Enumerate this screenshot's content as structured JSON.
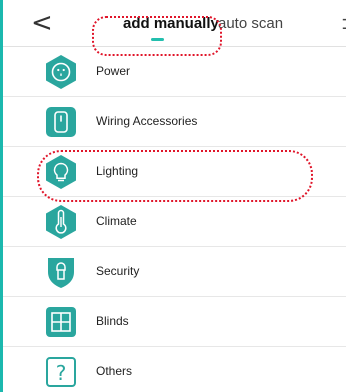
{
  "header": {
    "back_glyph": "<",
    "tabs": [
      {
        "label": "add manually",
        "active": true
      },
      {
        "label": "auto scan",
        "active": false
      }
    ],
    "scan_glyph": "⊐"
  },
  "categories": [
    {
      "label": "Power",
      "icon": "power-outlet-icon"
    },
    {
      "label": "Wiring Accessories",
      "icon": "wall-switch-icon"
    },
    {
      "label": "Lighting",
      "icon": "light-bulb-icon"
    },
    {
      "label": "Climate",
      "icon": "thermometer-icon"
    },
    {
      "label": "Security",
      "icon": "lock-shield-icon"
    },
    {
      "label": "Blinds",
      "icon": "window-blinds-icon"
    },
    {
      "label": "Others",
      "icon": "question-mark-icon"
    }
  ],
  "colors": {
    "accent": "#2aa69e",
    "annotation": "#e0152a",
    "tab_underline": "#23bfae"
  }
}
